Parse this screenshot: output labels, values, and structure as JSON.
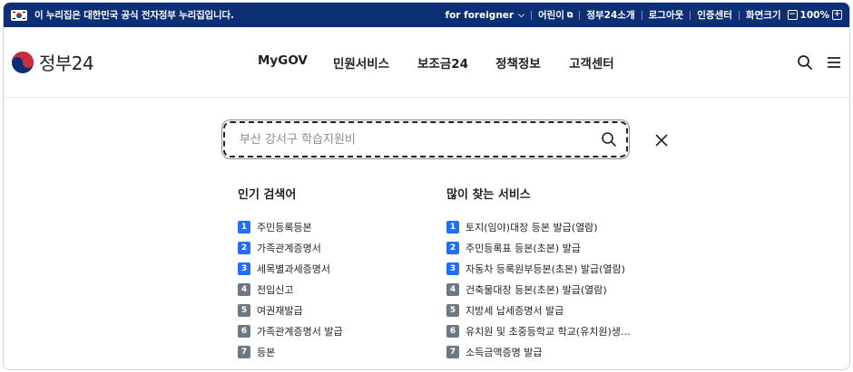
{
  "topbar": {
    "notice": "이 누리집은 대한민국 공식 전자정부 누리집입니다.",
    "links": [
      "for foreigner",
      "어린이",
      "정부24소개",
      "로그아웃",
      "인증센터",
      "화면크기"
    ],
    "zoom": "100%",
    "zoom_minus": "−",
    "zoom_plus": "+"
  },
  "header": {
    "logo_text": "정부24",
    "nav": [
      "MyGOV",
      "민원서비스",
      "보조금24",
      "정책정보",
      "고객센터"
    ]
  },
  "search": {
    "placeholder": "부산 강서구 학습지원비",
    "value": ""
  },
  "popular": {
    "title": "인기 검색어",
    "items": [
      "주민등록등본",
      "가족관계증명서",
      "세목별과세증명서",
      "전입신고",
      "여권재발급",
      "가족관계증명서 발급",
      "등본"
    ]
  },
  "frequent": {
    "title": "많이 찾는 서비스",
    "items": [
      "토지(임야)대장 등본 발급(열람)",
      "주민등록표 등본(초본) 발급",
      "자동차 등록원부등본(초본) 발급(열람)",
      "건축물대장 등본(초본) 발급(열람)",
      "지방세 납세증명서 발급",
      "유치원 및 초중등학교 학교(유치원)생…",
      "소득금액증명 발급"
    ]
  },
  "ranks": [
    "1",
    "2",
    "3",
    "4",
    "5",
    "6",
    "7"
  ],
  "colors": {
    "topbar": "#0b2e75",
    "rank_top": "#256ef4",
    "rank_other": "#6d7882"
  }
}
